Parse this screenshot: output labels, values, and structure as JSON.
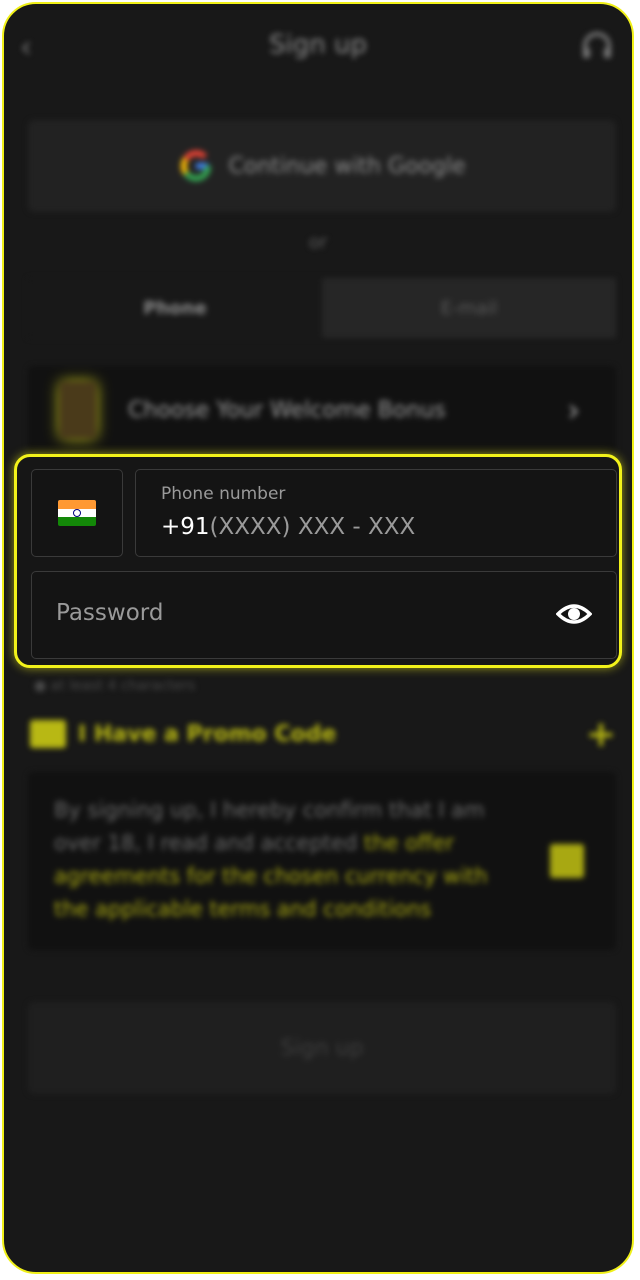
{
  "header": {
    "title": "Sign up",
    "back_icon": "chevron-left-icon",
    "support_icon": "headset-icon"
  },
  "google": {
    "label": "Continue with Google",
    "icon": "google-icon"
  },
  "divider": {
    "text": "or"
  },
  "tabs": [
    {
      "label": "Phone",
      "active": true
    },
    {
      "label": "E-mail",
      "active": false
    }
  ],
  "bonus": {
    "label": "Choose Your Welcome Bonus",
    "icon": "gift-icon",
    "arrow_icon": "chevron-right-icon"
  },
  "phone_form": {
    "country_flag": "india-flag-icon",
    "phone_label": "Phone number",
    "phone_prefix": "+91",
    "phone_mask": "(XXXX) XXX - XXX",
    "password_placeholder": "Password",
    "eye_icon": "eye-icon"
  },
  "password_hint": "at least 4 characters",
  "promo": {
    "label": "I Have a Promo Code",
    "icon": "ticket-icon",
    "plus_icon": "plus-icon"
  },
  "terms": {
    "text_plain": "By signing up, I hereby confirm that I am over 18, I read and accepted ",
    "text_link": "the offer agreements for the chosen currency with the applicable terms and conditions",
    "checked": true
  },
  "submit": {
    "label": "Sign up"
  },
  "colors": {
    "accent": "#f2f21a",
    "background": "#181818"
  }
}
